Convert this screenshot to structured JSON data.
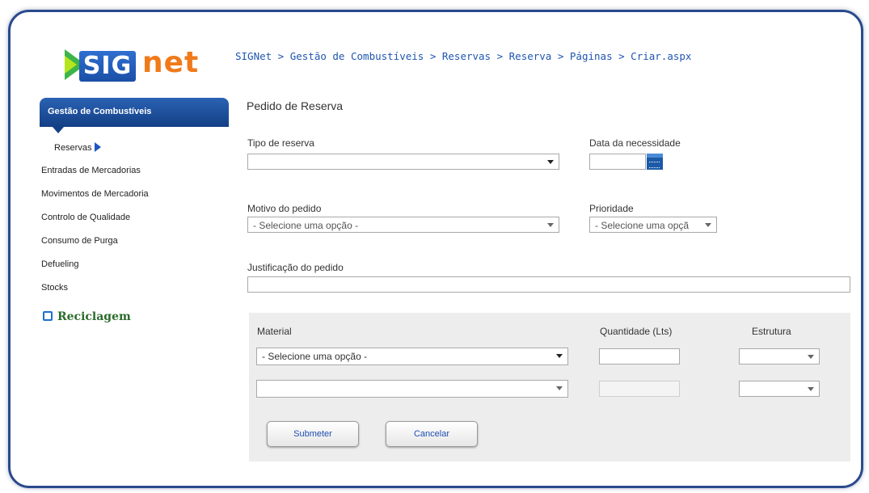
{
  "logo": {
    "sig": "SIG",
    "net": "net"
  },
  "nav": {
    "active_section": "Gestão de Combustíveis",
    "sub_item": "Reservas",
    "items": [
      "Entradas de Mercadorias",
      "Movimentos de Mercadoria",
      "Controlo de Qualidade",
      "Consumo de Purga",
      "Defueling",
      "Stocks"
    ],
    "recycle": "Reciclagem"
  },
  "breadcrumb": "SIGNet > Gestão de Combustíveis > Reservas > Reserva > Páginas > Criar.aspx",
  "page_title": "Pedido de Reserva",
  "form": {
    "tipo_label": "Tipo de reserva",
    "tipo_value": "",
    "data_label": "Data da necessidade",
    "data_value": "",
    "motivo_label": "Motivo do pedido",
    "motivo_value": "- Selecione uma opção -",
    "prioridade_label": "Prioridade",
    "prioridade_value": "- Selecione uma opçã",
    "justificacao_label": "Justificação do pedido",
    "justificacao_value": ""
  },
  "materials": {
    "col_material": "Material",
    "col_quantidade": "Quantidade (Lts)",
    "col_estrutura": "Estrutura",
    "rows": [
      {
        "material": "- Selecione uma opção -",
        "quantidade": "",
        "estrutura": ""
      },
      {
        "material": "",
        "quantidade": "",
        "estrutura": ""
      }
    ]
  },
  "buttons": {
    "submit": "Submeter",
    "cancel": "Cancelar"
  },
  "colors": {
    "frame": "#2a4a8c",
    "nav_active": "#1a4a97",
    "link": "#1f56b0",
    "logo_net": "#f07a1a",
    "logo_sig": "#2f6fd1",
    "recycle": "#2a6b2a"
  }
}
